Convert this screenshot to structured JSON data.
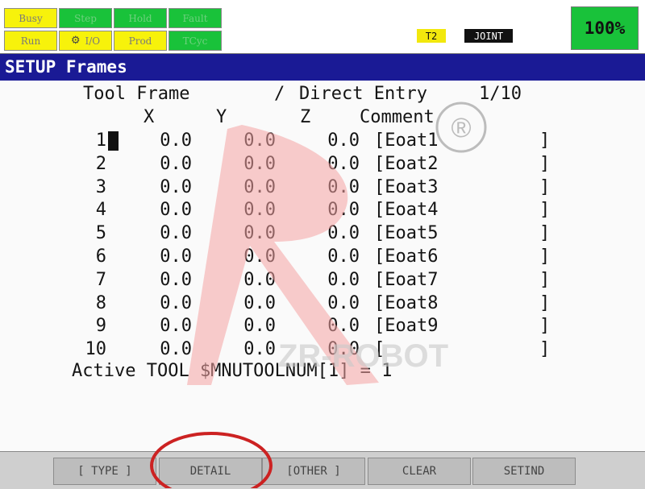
{
  "status": {
    "leds": [
      {
        "label": "Busy",
        "color": "yellow"
      },
      {
        "label": "Step",
        "color": "green"
      },
      {
        "label": "Hold",
        "color": "green"
      },
      {
        "label": "Fault",
        "color": "green"
      },
      {
        "label": "Run",
        "color": "yellow"
      },
      {
        "label": "I/O",
        "color": "yellow",
        "icon": "robot-arm-icon"
      },
      {
        "label": "Prod",
        "color": "yellow"
      },
      {
        "label": "TCyc",
        "color": "green"
      }
    ],
    "mode": "T2",
    "coord": "JOINT",
    "override": "100%"
  },
  "title": "SETUP Frames",
  "header": {
    "frame_label": "Tool Frame",
    "separator": "/",
    "entry_mode": "Direct Entry",
    "page": "1/10"
  },
  "columns": {
    "x": "X",
    "y": "Y",
    "z": "Z",
    "comment": "Comment"
  },
  "frames": [
    {
      "no": "1",
      "x": "0.0",
      "y": "0.0",
      "z": "0.0",
      "comment": "[Eoat1",
      "close": "]"
    },
    {
      "no": "2",
      "x": "0.0",
      "y": "0.0",
      "z": "0.0",
      "comment": "[Eoat2",
      "close": "]"
    },
    {
      "no": "3",
      "x": "0.0",
      "y": "0.0",
      "z": "0.0",
      "comment": "[Eoat3",
      "close": "]"
    },
    {
      "no": "4",
      "x": "0.0",
      "y": "0.0",
      "z": "0.0",
      "comment": "[Eoat4",
      "close": "]"
    },
    {
      "no": "5",
      "x": "0.0",
      "y": "0.0",
      "z": "0.0",
      "comment": "[Eoat5",
      "close": "]"
    },
    {
      "no": "6",
      "x": "0.0",
      "y": "0.0",
      "z": "0.0",
      "comment": "[Eoat6",
      "close": "]"
    },
    {
      "no": "7",
      "x": "0.0",
      "y": "0.0",
      "z": "0.0",
      "comment": "[Eoat7",
      "close": "]"
    },
    {
      "no": "8",
      "x": "0.0",
      "y": "0.0",
      "z": "0.0",
      "comment": "[Eoat8",
      "close": "]"
    },
    {
      "no": "9",
      "x": "0.0",
      "y": "0.0",
      "z": "0.0",
      "comment": "[Eoat9",
      "close": "]"
    },
    {
      "no": "10",
      "x": "0.0",
      "y": "0.0",
      "z": "0.0",
      "comment": "[",
      "close": "]"
    }
  ],
  "active_tool": "Active TOOL $MNUTOOLNUM[1] = 1",
  "watermark": {
    "text": "ZR-ROBOT",
    "mark": "®"
  },
  "fkeys": [
    "[ TYPE ]",
    "DETAIL",
    "[OTHER ]",
    "CLEAR",
    "SETIND"
  ],
  "colors": {
    "title_bar": "#1a1a95",
    "led_yellow": "#f7f20b",
    "led_green": "#19c23a",
    "annotation": "#cc2222"
  }
}
